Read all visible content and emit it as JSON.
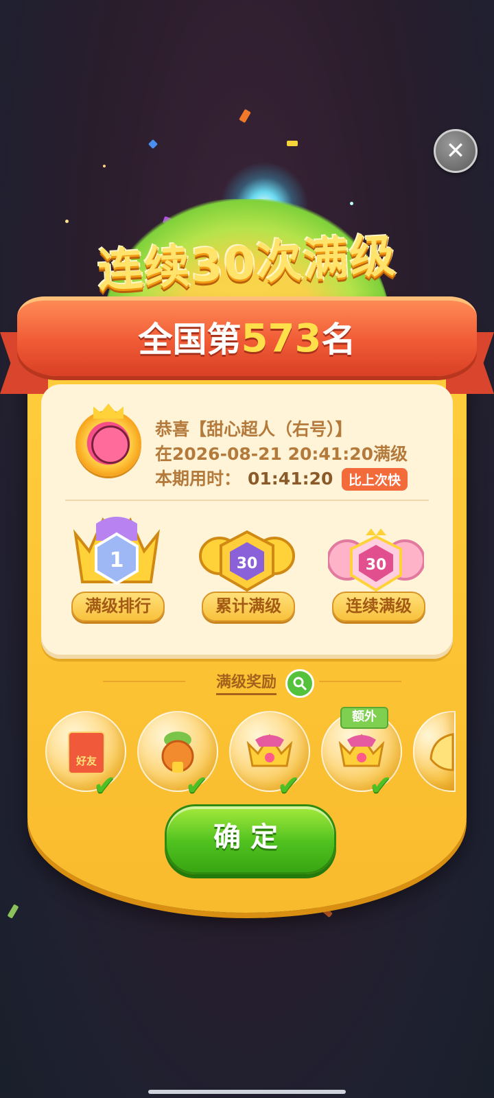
{
  "title": "连续30次满级",
  "rank": {
    "prefix": "全国第",
    "number": "573",
    "suffix": "名"
  },
  "info": {
    "line1": "恭喜【甜心超人（右号）】",
    "line2": "在2026-08-21 20:41:20满级",
    "time_label": "本期用时：",
    "time_value": "01:41:20",
    "badge": "比上次快"
  },
  "trophies": [
    {
      "label": "满级排行",
      "value": "1"
    },
    {
      "label": "累计满级",
      "value": "30"
    },
    {
      "label": "连续满级",
      "value": "30"
    }
  ],
  "rewards": {
    "title": "满级奖励",
    "items": [
      {
        "icon": "red-envelope-icon",
        "text": "好友",
        "claimed": true
      },
      {
        "icon": "flower-pot-icon",
        "claimed": true
      },
      {
        "icon": "crown-icon",
        "claimed": true
      },
      {
        "icon": "crown-icon",
        "claimed": true,
        "tag": "额外"
      },
      {
        "icon": "wing-icon",
        "claimed": false
      }
    ]
  },
  "confirm_label": "确定",
  "close_label": "✕",
  "check_glyph": "✔"
}
